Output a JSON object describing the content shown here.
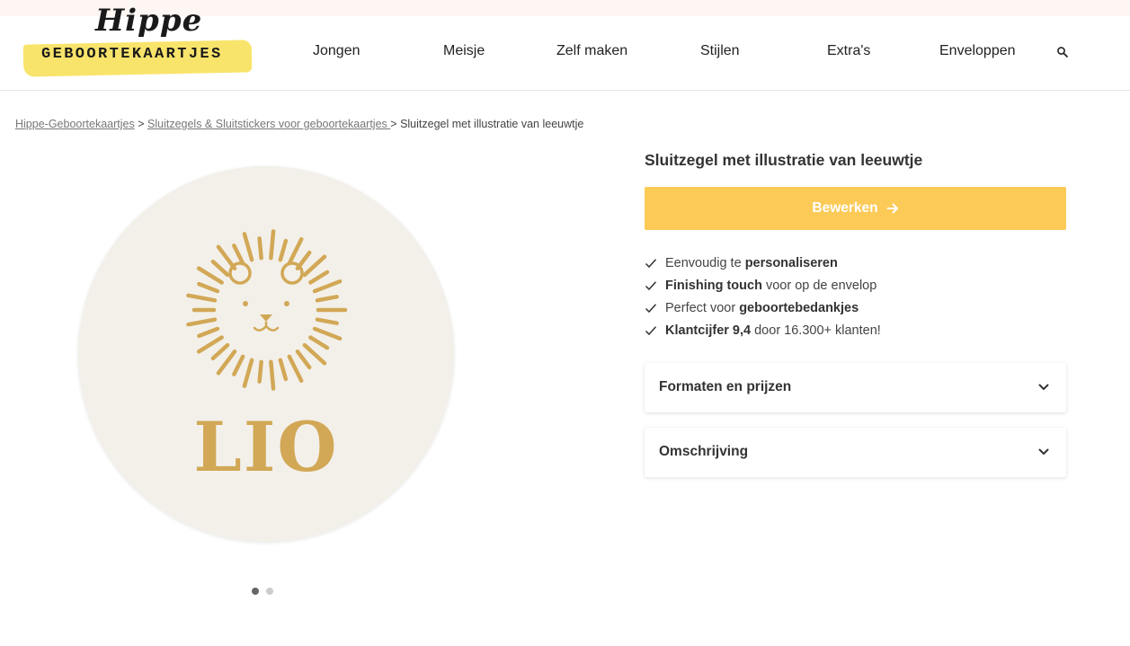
{
  "header": {
    "logo_script": "Hippe",
    "logo_text": "GEBOORTEKAARTJES",
    "nav": [
      "Jongen",
      "Meisje",
      "Zelf maken",
      "Stijlen",
      "Extra's",
      "Enveloppen"
    ]
  },
  "breadcrumb": {
    "items": [
      "Hippe-Geboortekaartjes",
      "Sluitzegels & Sluitstickers voor geboortekaartjes "
    ],
    "separator": ">",
    "current": "Sluitzegel met illustratie van leeuwtje"
  },
  "gallery": {
    "sticker_text": "LIO",
    "slide_count": 2,
    "active_slide": 1
  },
  "product": {
    "title": "Sluitzegel met illustratie van leeuwtje",
    "edit_label": "Bewerken",
    "features": [
      {
        "pre": "Eenvoudig te ",
        "bold": "personaliseren",
        "post": ""
      },
      {
        "pre": "",
        "bold": "Finishing touch",
        "post": " voor op de envelop"
      },
      {
        "pre": "Perfect voor ",
        "bold": "geboortebedankjes",
        "post": ""
      },
      {
        "pre": "",
        "bold": "Klantcijfer 9,4",
        "post": " door 16.300+ klanten!"
      }
    ],
    "accordions": [
      "Formaten en prijzen",
      "Omschrijving"
    ]
  },
  "colors": {
    "accent_yellow": "#fcca57",
    "logo_yellow": "#f9e46b",
    "lion_gold": "#d2a856",
    "sticker_bg": "#f3f0ea"
  },
  "icons": [
    "search-icon",
    "arrow-right-icon",
    "check-icon",
    "chevron-down-icon",
    "lion-illustration"
  ]
}
